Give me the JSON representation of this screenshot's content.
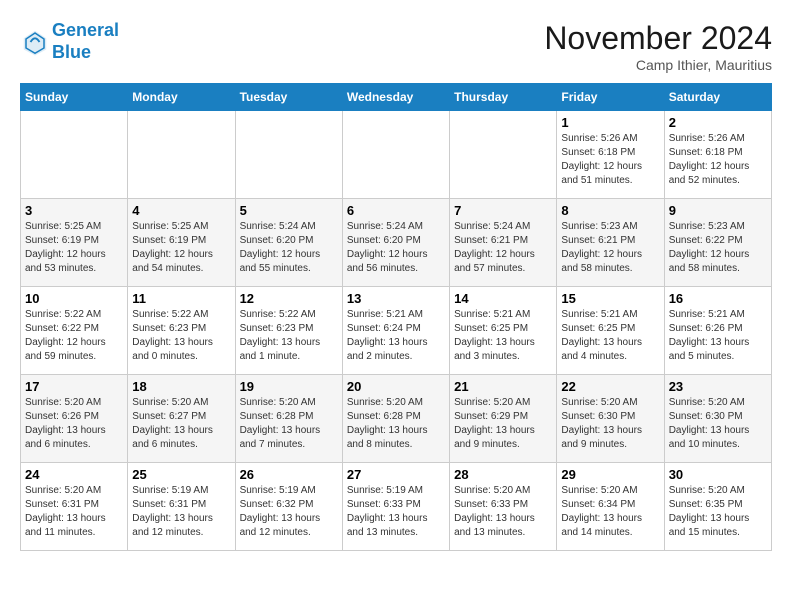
{
  "header": {
    "logo_line1": "General",
    "logo_line2": "Blue",
    "month": "November 2024",
    "location": "Camp Ithier, Mauritius"
  },
  "weekdays": [
    "Sunday",
    "Monday",
    "Tuesday",
    "Wednesday",
    "Thursday",
    "Friday",
    "Saturday"
  ],
  "weeks": [
    [
      {
        "day": "",
        "info": ""
      },
      {
        "day": "",
        "info": ""
      },
      {
        "day": "",
        "info": ""
      },
      {
        "day": "",
        "info": ""
      },
      {
        "day": "",
        "info": ""
      },
      {
        "day": "1",
        "info": "Sunrise: 5:26 AM\nSunset: 6:18 PM\nDaylight: 12 hours\nand 51 minutes."
      },
      {
        "day": "2",
        "info": "Sunrise: 5:26 AM\nSunset: 6:18 PM\nDaylight: 12 hours\nand 52 minutes."
      }
    ],
    [
      {
        "day": "3",
        "info": "Sunrise: 5:25 AM\nSunset: 6:19 PM\nDaylight: 12 hours\nand 53 minutes."
      },
      {
        "day": "4",
        "info": "Sunrise: 5:25 AM\nSunset: 6:19 PM\nDaylight: 12 hours\nand 54 minutes."
      },
      {
        "day": "5",
        "info": "Sunrise: 5:24 AM\nSunset: 6:20 PM\nDaylight: 12 hours\nand 55 minutes."
      },
      {
        "day": "6",
        "info": "Sunrise: 5:24 AM\nSunset: 6:20 PM\nDaylight: 12 hours\nand 56 minutes."
      },
      {
        "day": "7",
        "info": "Sunrise: 5:24 AM\nSunset: 6:21 PM\nDaylight: 12 hours\nand 57 minutes."
      },
      {
        "day": "8",
        "info": "Sunrise: 5:23 AM\nSunset: 6:21 PM\nDaylight: 12 hours\nand 58 minutes."
      },
      {
        "day": "9",
        "info": "Sunrise: 5:23 AM\nSunset: 6:22 PM\nDaylight: 12 hours\nand 58 minutes."
      }
    ],
    [
      {
        "day": "10",
        "info": "Sunrise: 5:22 AM\nSunset: 6:22 PM\nDaylight: 12 hours\nand 59 minutes."
      },
      {
        "day": "11",
        "info": "Sunrise: 5:22 AM\nSunset: 6:23 PM\nDaylight: 13 hours\nand 0 minutes."
      },
      {
        "day": "12",
        "info": "Sunrise: 5:22 AM\nSunset: 6:23 PM\nDaylight: 13 hours\nand 1 minute."
      },
      {
        "day": "13",
        "info": "Sunrise: 5:21 AM\nSunset: 6:24 PM\nDaylight: 13 hours\nand 2 minutes."
      },
      {
        "day": "14",
        "info": "Sunrise: 5:21 AM\nSunset: 6:25 PM\nDaylight: 13 hours\nand 3 minutes."
      },
      {
        "day": "15",
        "info": "Sunrise: 5:21 AM\nSunset: 6:25 PM\nDaylight: 13 hours\nand 4 minutes."
      },
      {
        "day": "16",
        "info": "Sunrise: 5:21 AM\nSunset: 6:26 PM\nDaylight: 13 hours\nand 5 minutes."
      }
    ],
    [
      {
        "day": "17",
        "info": "Sunrise: 5:20 AM\nSunset: 6:26 PM\nDaylight: 13 hours\nand 6 minutes."
      },
      {
        "day": "18",
        "info": "Sunrise: 5:20 AM\nSunset: 6:27 PM\nDaylight: 13 hours\nand 6 minutes."
      },
      {
        "day": "19",
        "info": "Sunrise: 5:20 AM\nSunset: 6:28 PM\nDaylight: 13 hours\nand 7 minutes."
      },
      {
        "day": "20",
        "info": "Sunrise: 5:20 AM\nSunset: 6:28 PM\nDaylight: 13 hours\nand 8 minutes."
      },
      {
        "day": "21",
        "info": "Sunrise: 5:20 AM\nSunset: 6:29 PM\nDaylight: 13 hours\nand 9 minutes."
      },
      {
        "day": "22",
        "info": "Sunrise: 5:20 AM\nSunset: 6:30 PM\nDaylight: 13 hours\nand 9 minutes."
      },
      {
        "day": "23",
        "info": "Sunrise: 5:20 AM\nSunset: 6:30 PM\nDaylight: 13 hours\nand 10 minutes."
      }
    ],
    [
      {
        "day": "24",
        "info": "Sunrise: 5:20 AM\nSunset: 6:31 PM\nDaylight: 13 hours\nand 11 minutes."
      },
      {
        "day": "25",
        "info": "Sunrise: 5:19 AM\nSunset: 6:31 PM\nDaylight: 13 hours\nand 12 minutes."
      },
      {
        "day": "26",
        "info": "Sunrise: 5:19 AM\nSunset: 6:32 PM\nDaylight: 13 hours\nand 12 minutes."
      },
      {
        "day": "27",
        "info": "Sunrise: 5:19 AM\nSunset: 6:33 PM\nDaylight: 13 hours\nand 13 minutes."
      },
      {
        "day": "28",
        "info": "Sunrise: 5:20 AM\nSunset: 6:33 PM\nDaylight: 13 hours\nand 13 minutes."
      },
      {
        "day": "29",
        "info": "Sunrise: 5:20 AM\nSunset: 6:34 PM\nDaylight: 13 hours\nand 14 minutes."
      },
      {
        "day": "30",
        "info": "Sunrise: 5:20 AM\nSunset: 6:35 PM\nDaylight: 13 hours\nand 15 minutes."
      }
    ]
  ]
}
